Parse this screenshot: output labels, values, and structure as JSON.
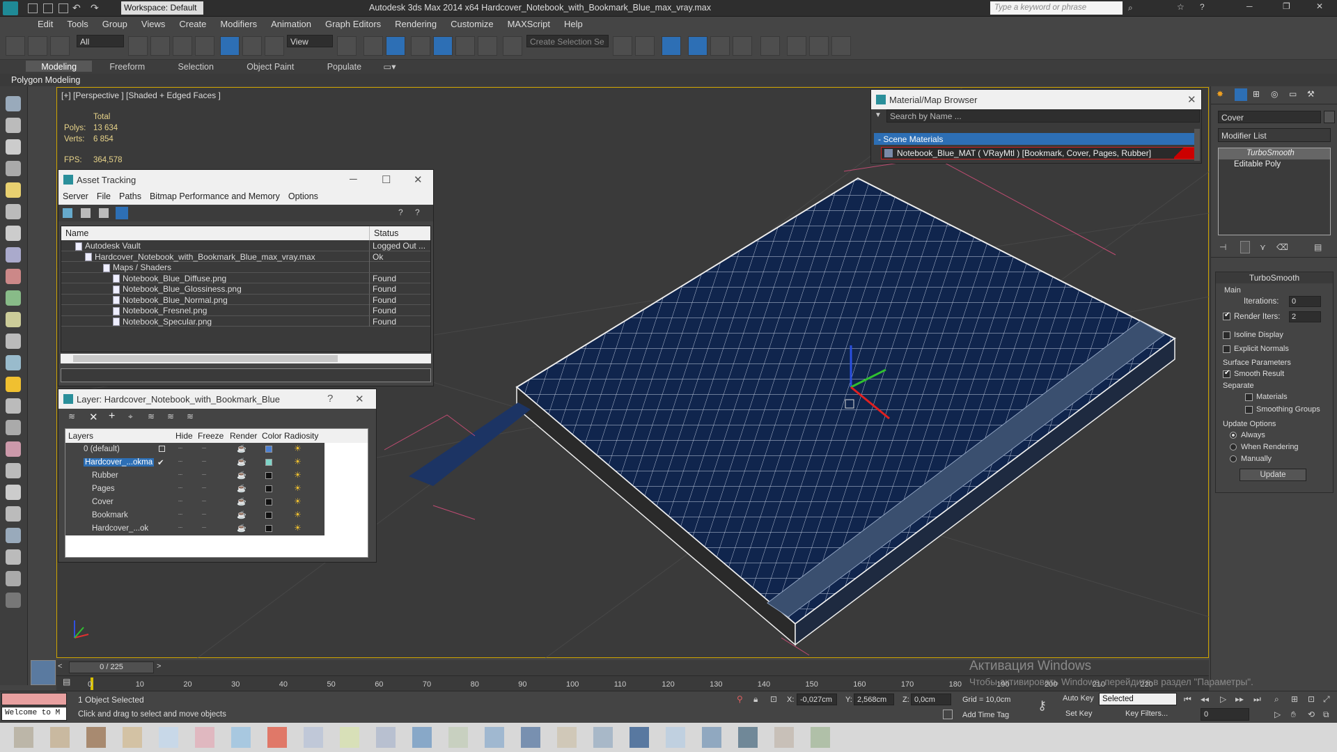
{
  "app": {
    "title": "Autodesk 3ds Max  2014 x64    Hardcover_Notebook_with_Bookmark_Blue_max_vray.max",
    "workspace": "Workspace: Default",
    "search_placeholder": "Type a keyword or phrase"
  },
  "menu": [
    "Edit",
    "Tools",
    "Group",
    "Views",
    "Create",
    "Modifiers",
    "Animation",
    "Graph Editors",
    "Rendering",
    "Customize",
    "MAXScript",
    "Help"
  ],
  "toolbar": {
    "selection_filter": "All",
    "ref_coord": "View",
    "named_selection": "Create Selection Se"
  },
  "ribbon": {
    "tabs": [
      "Modeling",
      "Freeform",
      "Selection",
      "Object Paint",
      "Populate"
    ],
    "active": "Modeling",
    "sub_label": "Polygon Modeling"
  },
  "viewport": {
    "label": "[+] [Perspective ] [Shaded + Edged Faces ]",
    "stats_header": "Total",
    "polys_label": "Polys:",
    "polys_value": "13 634",
    "verts_label": "Verts:",
    "verts_value": "6 854",
    "fps_label": "FPS:",
    "fps_value": "364,578"
  },
  "asset_tracking": {
    "title": "Asset Tracking",
    "menu": [
      "Server",
      "File",
      "Paths",
      "Bitmap Performance and Memory",
      "Options"
    ],
    "col_name": "Name",
    "col_status": "Status",
    "rows": [
      {
        "name": "Autodesk Vault",
        "status": "Logged Out ..."
      },
      {
        "name": "Hardcover_Notebook_with_Bookmark_Blue_max_vray.max",
        "status": "Ok"
      },
      {
        "name": "Maps / Shaders",
        "status": ""
      },
      {
        "name": "Notebook_Blue_Diffuse.png",
        "status": "Found"
      },
      {
        "name": "Notebook_Blue_Glossiness.png",
        "status": "Found"
      },
      {
        "name": "Notebook_Blue_Normal.png",
        "status": "Found"
      },
      {
        "name": "Notebook_Fresnel.png",
        "status": "Found"
      },
      {
        "name": "Notebook_Specular.png",
        "status": "Found"
      }
    ]
  },
  "layer_dialog": {
    "title": "Layer: Hardcover_Notebook_with_Bookmark_Blue",
    "help": "?",
    "columns": [
      "Layers",
      "Hide",
      "Freeze",
      "Render",
      "Color",
      "Radiosity"
    ],
    "rows": [
      {
        "name": "0 (default)",
        "color": "#4a7fd4"
      },
      {
        "name": "Hardcover_...okma",
        "color": "#7fd4c8"
      },
      {
        "name": "Rubber",
        "color": "#111111"
      },
      {
        "name": "Pages",
        "color": "#111111"
      },
      {
        "name": "Cover",
        "color": "#111111"
      },
      {
        "name": "Bookmark",
        "color": "#111111"
      },
      {
        "name": "Hardcover_...ok",
        "color": "#111111"
      }
    ]
  },
  "material_browser": {
    "title": "Material/Map Browser",
    "search_placeholder": "Search by Name ...",
    "section": "- Scene Materials",
    "item": "Notebook_Blue_MAT  ( VRayMtl )  [Bookmark, Cover, Pages, Rubber]"
  },
  "command_panel": {
    "object_name": "Cover",
    "modifier_list": "Modifier List",
    "stack": [
      "TurboSmooth",
      "Editable Poly"
    ],
    "rollout_title": "TurboSmooth",
    "main_label": "Main",
    "iterations_label": "Iterations:",
    "iterations_value": "0",
    "render_iters_label": "Render Iters:",
    "render_iters_value": "2",
    "isoline": "Isoline Display",
    "explicit_normals": "Explicit Normals",
    "surface_params": "Surface Parameters",
    "smooth_result": "Smooth Result",
    "separate": "Separate",
    "materials": "Materials",
    "smoothing_groups": "Smoothing Groups",
    "update_options": "Update Options",
    "always": "Always",
    "when_rendering": "When Rendering",
    "manually": "Manually",
    "update_btn": "Update"
  },
  "timeline": {
    "frame": "0 / 225",
    "ticks": [
      "0",
      "10",
      "20",
      "30",
      "40",
      "50",
      "60",
      "70",
      "80",
      "90",
      "100",
      "110",
      "120",
      "130",
      "140",
      "150",
      "160",
      "170",
      "180",
      "190",
      "200",
      "210",
      "220"
    ]
  },
  "status": {
    "welcome": "Welcome to M",
    "selected": "1 Object Selected",
    "prompt": "Click and drag to select and move objects",
    "x_label": "X:",
    "x_value": "-0,027cm",
    "y_label": "Y:",
    "y_value": "2,568cm",
    "z_label": "Z:",
    "z_value": "0,0cm",
    "grid": "Grid = 10,0cm",
    "add_time_tag": "Add Time Tag",
    "auto_key": "Auto Key",
    "set_key": "Set Key",
    "key_mode": "Selected",
    "key_filters": "Key Filters...",
    "frame_field": "0"
  },
  "watermark": {
    "line1": "Активация Windows",
    "line2": "Чтобы активировать Windows, перейдите в раздел \"Параметры\"."
  }
}
